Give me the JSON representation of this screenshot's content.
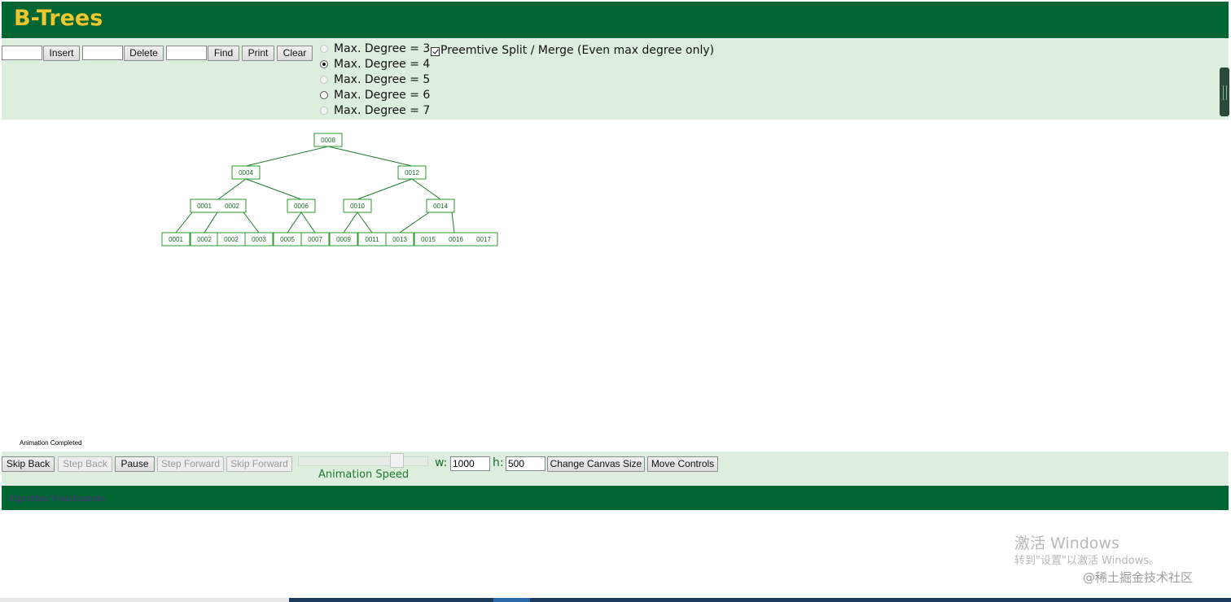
{
  "header": {
    "title": "B-Trees"
  },
  "toolbar": {
    "insert_value": "",
    "insert_label": "Insert",
    "delete_value": "",
    "delete_label": "Delete",
    "find_value": "",
    "find_label": "Find",
    "print_label": "Print",
    "clear_label": "Clear"
  },
  "degree_options": [
    {
      "label": "Max. Degree = 3",
      "checked": false,
      "disabled": true
    },
    {
      "label": "Max. Degree = 4",
      "checked": true,
      "disabled": false
    },
    {
      "label": "Max. Degree = 5",
      "checked": false,
      "disabled": true
    },
    {
      "label": "Max. Degree = 6",
      "checked": false,
      "disabled": false
    },
    {
      "label": "Max. Degree = 7",
      "checked": false,
      "disabled": true
    }
  ],
  "preemptive": {
    "label": "Preemtive Split / Merge (Even max degree only)",
    "checked": true
  },
  "tree": {
    "nodes": [
      {
        "id": "root",
        "keys": [
          "0008"
        ]
      },
      {
        "id": "l1a",
        "keys": [
          "0004"
        ]
      },
      {
        "id": "l1b",
        "keys": [
          "0012"
        ]
      },
      {
        "id": "l2a",
        "keys": [
          "0001",
          "0002"
        ]
      },
      {
        "id": "l2b",
        "keys": [
          "0006"
        ]
      },
      {
        "id": "l2c",
        "keys": [
          "0010"
        ]
      },
      {
        "id": "l2d",
        "keys": [
          "0014"
        ]
      },
      {
        "id": "leaf1",
        "keys": [
          "0001"
        ]
      },
      {
        "id": "leaf2",
        "keys": [
          "0002"
        ]
      },
      {
        "id": "leaf3",
        "keys": [
          "0002"
        ]
      },
      {
        "id": "leaf4",
        "keys": [
          "0003"
        ]
      },
      {
        "id": "leaf5",
        "keys": [
          "0005"
        ]
      },
      {
        "id": "leaf6",
        "keys": [
          "0007"
        ]
      },
      {
        "id": "leaf7",
        "keys": [
          "0009"
        ]
      },
      {
        "id": "leaf8",
        "keys": [
          "0011"
        ]
      },
      {
        "id": "leaf9",
        "keys": [
          "0013"
        ]
      },
      {
        "id": "leaf10",
        "keys": [
          "0015",
          "0016",
          "0017"
        ]
      }
    ],
    "edges": [
      [
        "root",
        "l1a"
      ],
      [
        "root",
        "l1b"
      ],
      [
        "l1a",
        "l2a"
      ],
      [
        "l1a",
        "l2b"
      ],
      [
        "l1b",
        "l2c"
      ],
      [
        "l1b",
        "l2d"
      ],
      [
        "l2a",
        "leaf1"
      ],
      [
        "l2a",
        "leaf2"
      ],
      [
        "l2a",
        "leaf4"
      ],
      [
        "l2b",
        "leaf5"
      ],
      [
        "l2b",
        "leaf6"
      ],
      [
        "l2c",
        "leaf7"
      ],
      [
        "l2c",
        "leaf8"
      ],
      [
        "l2d",
        "leaf9"
      ],
      [
        "l2d",
        "leaf10"
      ]
    ],
    "node_color": "#2e9a2e",
    "edge_color": "#1a7a2a"
  },
  "status_text": "Animation Completed",
  "animation": {
    "skip_back": "Skip Back",
    "step_back": "Step Back",
    "pause": "Pause",
    "step_forward": "Step Forward",
    "skip_forward": "Skip Forward",
    "speed_label": "Animation Speed",
    "speed": 0.75,
    "w_label": "w:",
    "w_value": "1000",
    "h_label": "h:",
    "h_value": "500",
    "change_canvas": "Change Canvas Size",
    "move_controls": "Move Controls"
  },
  "footer": {
    "link_text": "Algorithm Visualizations"
  },
  "watermark": {
    "line1": "激活 Windows",
    "line2": "转到\"设置\"以激活 Windows。",
    "line3": "@稀土掘金技术社区"
  },
  "colors": {
    "header_bg": "#006633",
    "panel_bg": "#deeede",
    "title": "#f0c62e"
  }
}
